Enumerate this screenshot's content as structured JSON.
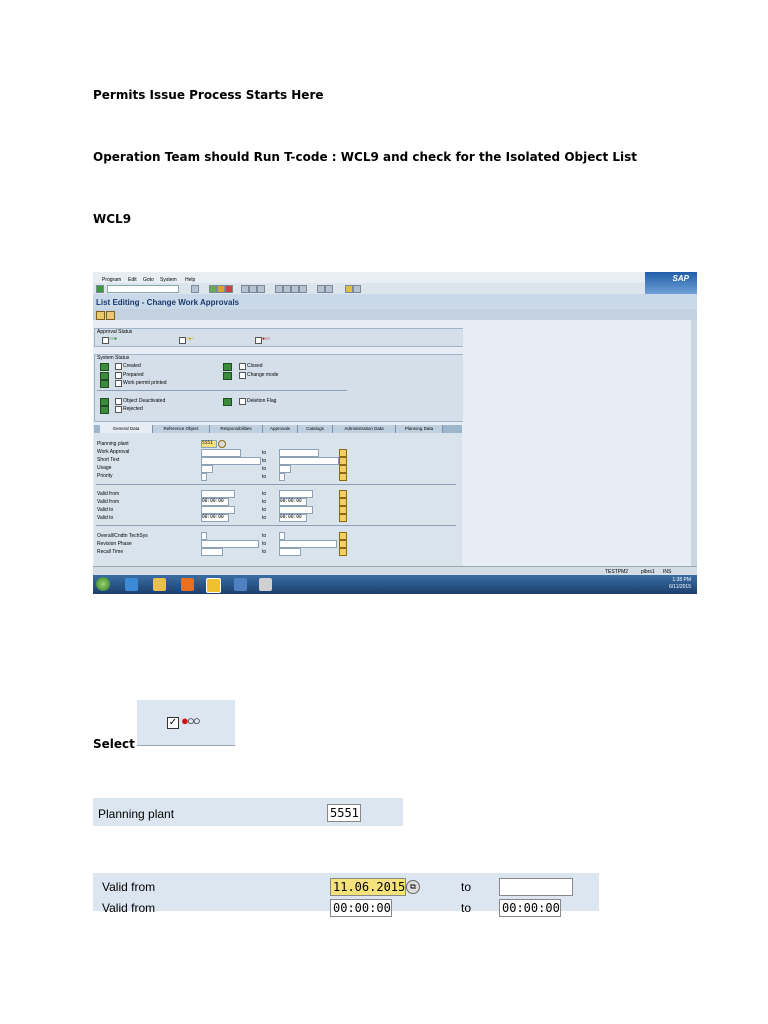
{
  "doc": {
    "heading1": "Permits Issue Process Starts Here",
    "heading2": "Operation Team should Run T-code : WCL9 and check for the Isolated Object List",
    "heading3": "WCL9",
    "select_label": "Select"
  },
  "sap": {
    "menu": [
      "Program",
      "Edit",
      "Goto",
      "System",
      "Help"
    ],
    "logo": "SAP",
    "title": "List Editing - Change Work Approvals",
    "approval_status": {
      "title": "Approval Status"
    },
    "system_status": {
      "title": "System Status",
      "items": [
        "Created",
        "Prepared",
        "Work permit printed",
        "Object Deactivated",
        "Rejected",
        "Closed",
        "Change mode",
        "Deletion Flag"
      ]
    },
    "tabs": [
      "General Data",
      "Reference Object",
      "Responsibilities",
      "Approvals",
      "Catalogs",
      "Administration Data",
      "Planning Data"
    ],
    "fields": {
      "planning_plant_label": "Planning plant",
      "planning_plant_value": "5551",
      "work_approval": "Work Approval",
      "short_text": "Short Text",
      "usage": "Usage",
      "priority": "Priority",
      "valid_from": "Valid from",
      "valid_to": "Valid to",
      "time_zero": "00:00:00",
      "overall_techsys": "Overall/Cndtn TechSys",
      "revision_phase": "Revision Phase",
      "recall_time": "Recall Time",
      "to": "to"
    },
    "status_bar": {
      "system": "TESTPM2",
      "client": "plbrs1",
      "mode": "INS"
    },
    "clock": {
      "time": "1:38 PM",
      "date": "6/11/2015"
    }
  },
  "crops": {
    "planning_plant_label": "Planning plant",
    "planning_plant_value": "5551",
    "valid_from_label": "Valid from",
    "valid_from_date": "11.06.2015",
    "to": "to",
    "time_zero": "00:00:00"
  }
}
